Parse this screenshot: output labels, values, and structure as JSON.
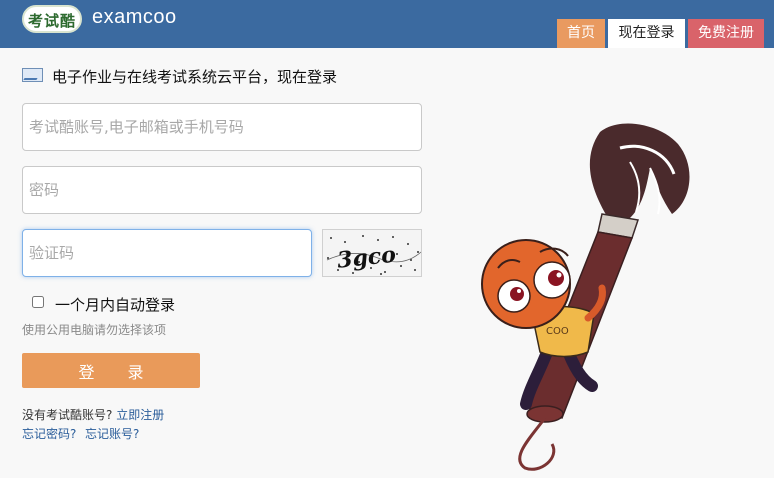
{
  "header": {
    "logo_text": "考试酷",
    "brand": "examcoo",
    "nav": {
      "home": "首页",
      "login": "现在登录",
      "register": "免费注册"
    }
  },
  "subtitle": "电子作业与在线考试系统云平台，现在登录",
  "form": {
    "account_placeholder": "考试酷账号,电子邮箱或手机号码",
    "password_placeholder": "密码",
    "captcha_placeholder": "验证码",
    "captcha_image_text": "3gco",
    "remember_label": "一个月内自动登录",
    "public_pc_hint": "使用公用电脑请勿选择该项",
    "login_button": "登 录",
    "no_account_text": "没有考试酷账号?",
    "register_link": "立即注册",
    "forgot_password_link": "忘记密码?",
    "forgot_account_link": "忘记账号?"
  },
  "mascot": {
    "shirt_text": "COO"
  },
  "colors": {
    "header_bg": "#3b6aa0",
    "nav_home": "#e99a60",
    "nav_register": "#d9636a",
    "login_button": "#e99a5a",
    "link": "#2a5d9a"
  }
}
